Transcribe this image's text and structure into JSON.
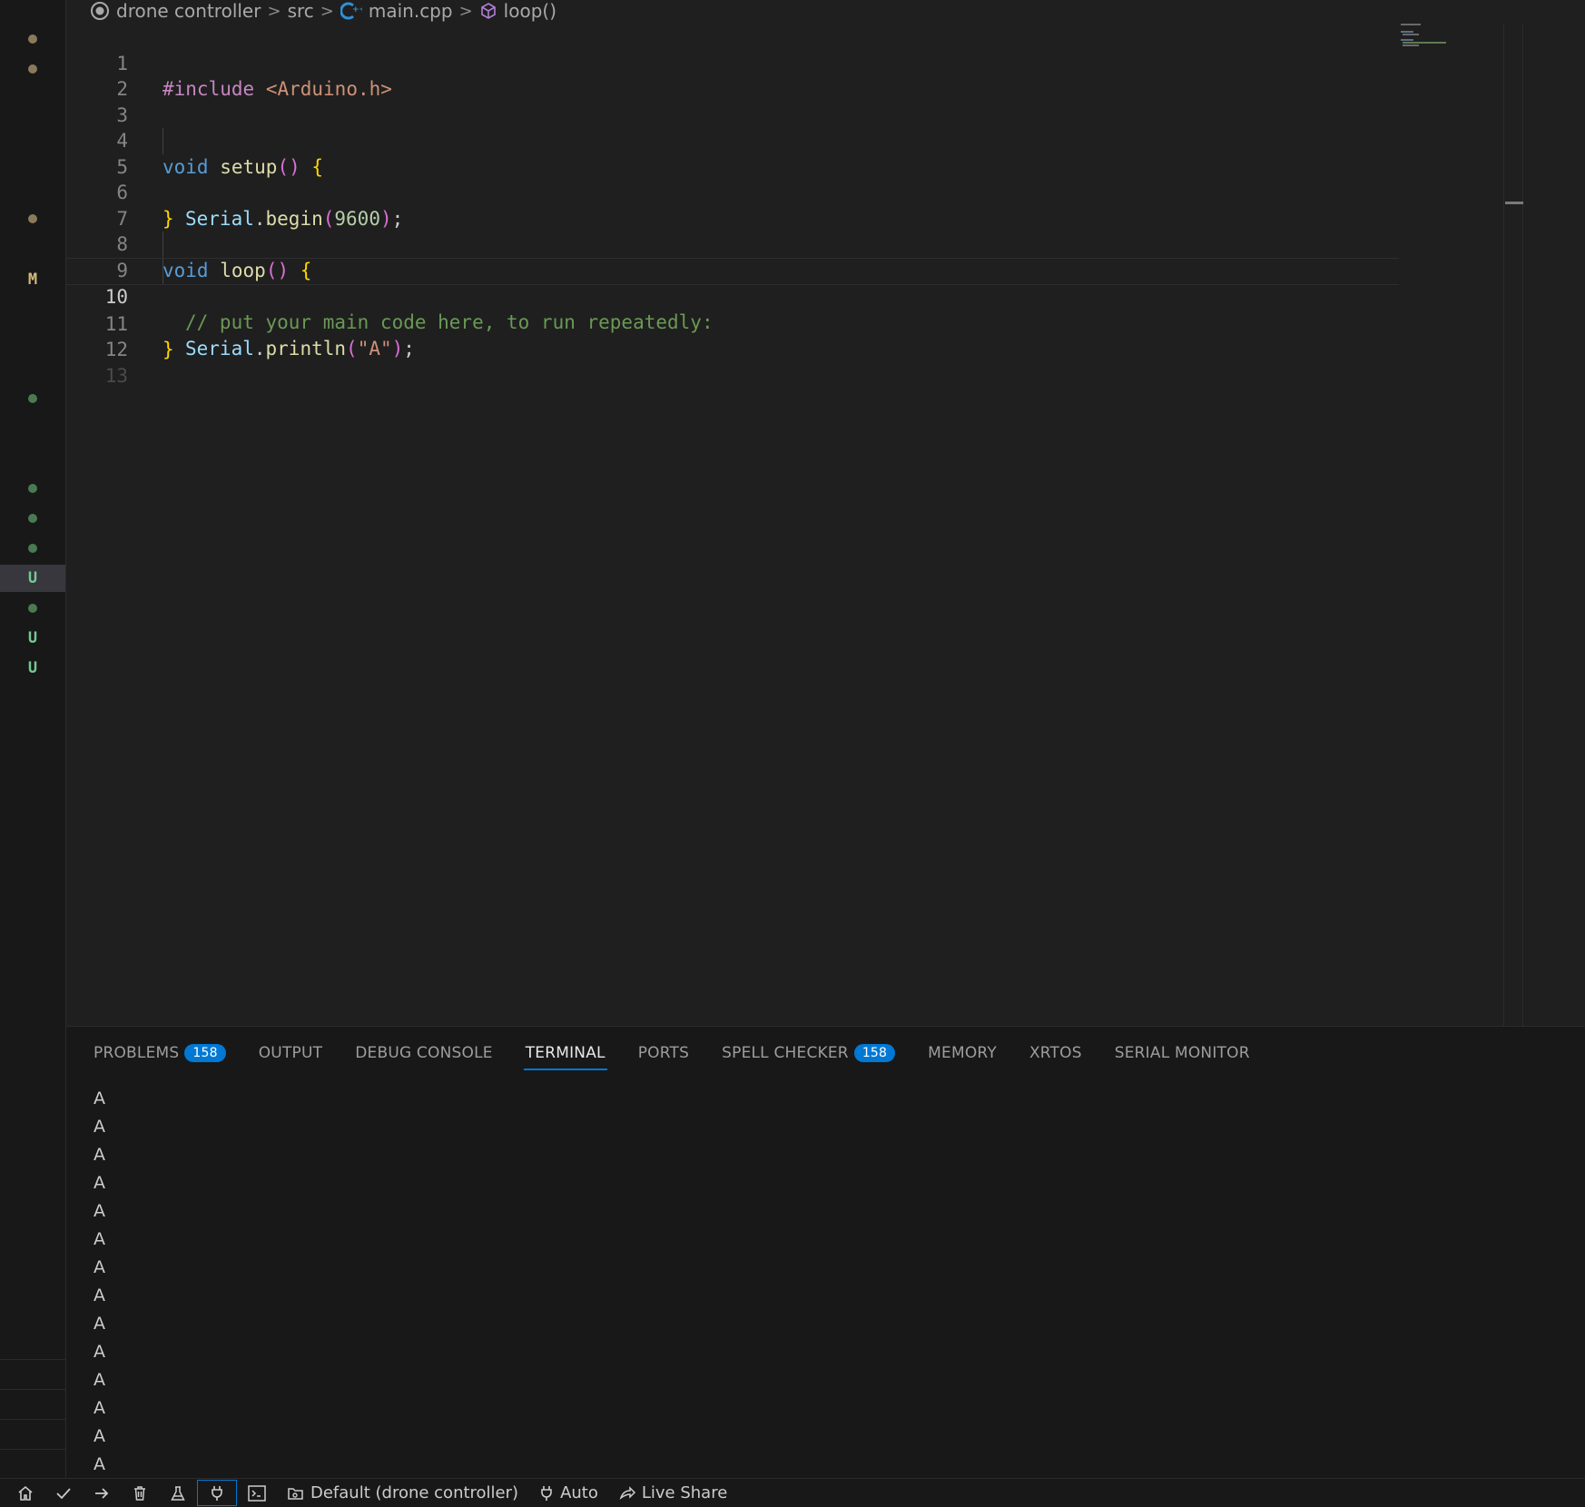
{
  "breadcrumb": {
    "project": "drone controller",
    "folder": "src",
    "file": "main.cpp",
    "symbol": "loop()"
  },
  "editor": {
    "current_line": 10,
    "line_numbers": [
      "1",
      "2",
      "3",
      "4",
      "5",
      "6",
      "7",
      "8",
      "9",
      "10",
      "11",
      "12",
      "13"
    ],
    "lines": {
      "l1": {
        "pre": "#include",
        "inc": "<Arduino.h>"
      },
      "l4": {
        "kw": "void",
        "fn": "setup",
        "open": "()",
        "brace": "{"
      },
      "l5": {
        "obj": "Serial",
        "dot": ".",
        "fn": "begin",
        "lp": "(",
        "num": "9600",
        "rp": ")",
        "semi": ";"
      },
      "l6": {
        "brace": "}"
      },
      "l8": {
        "kw": "void",
        "fn": "loop",
        "open": "()",
        "brace": "{"
      },
      "l9": {
        "comment": "// put your main code here, to run repeatedly:"
      },
      "l10": {
        "obj": "Serial",
        "dot": ".",
        "fn": "println",
        "lp": "(",
        "str": "\"A\"",
        "rp": ")",
        "semi": ";"
      },
      "l11": {
        "brace": "}"
      }
    }
  },
  "scm_gutter": [
    "modified-dot",
    "modified-dot",
    "modified-dot",
    "M",
    "added-dot",
    "added-dot",
    "added-dot",
    "added-dot",
    "U",
    "added-dot",
    "U",
    "U"
  ],
  "scm_letters": {
    "m": "M",
    "u1": "U",
    "u2": "U",
    "u3": "U"
  },
  "panel": {
    "tabs": {
      "problems": "PROBLEMS",
      "problems_count": "158",
      "output": "OUTPUT",
      "debug_console": "DEBUG CONSOLE",
      "terminal": "TERMINAL",
      "ports": "PORTS",
      "spell_checker": "SPELL CHECKER",
      "spell_checker_count": "158",
      "memory": "MEMORY",
      "xrtos": "XRTOS",
      "serial_monitor": "SERIAL MONITOR"
    },
    "active_tab": "TERMINAL",
    "terminal_lines": [
      "A",
      "A",
      "A",
      "A",
      "A",
      "A",
      "A",
      "A",
      "A",
      "A",
      "A",
      "A",
      "A",
      "A"
    ]
  },
  "statusbar": {
    "environment": "Default (drone controller)",
    "port": "Auto",
    "live_share": "Live Share",
    "icons": [
      "home-icon",
      "check-icon",
      "arrow-right-icon",
      "trash-icon",
      "flask-icon",
      "plug-icon",
      "terminal-icon"
    ]
  },
  "colors": {
    "accent": "#0078d4",
    "modified": "#8a7a5c",
    "added": "#4a7a52",
    "m_letter": "#d7ba7d",
    "u_letter": "#73c991"
  }
}
